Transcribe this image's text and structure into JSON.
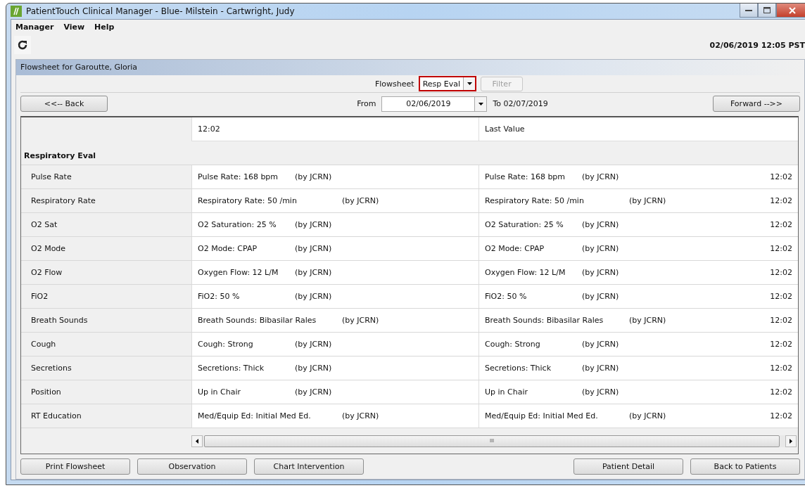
{
  "window": {
    "title": "PatientTouch Clinical Manager - Blue- Milstein - Cartwright, Judy"
  },
  "menu": [
    "Manager",
    "View",
    "Help"
  ],
  "toolbar": {
    "datetime": "02/06/2019 12:05 PST"
  },
  "panel": {
    "title": "Flowsheet for Garoutte, Gloria"
  },
  "flowsheet": {
    "label": "Flowsheet",
    "value": "Resp Eval",
    "highlighted": true,
    "filter": {
      "label": "Filter",
      "disabled": true
    }
  },
  "navigation": {
    "back": "<<-- Back",
    "from_label": "From",
    "from_value": "02/06/2019",
    "to_text": "To 02/07/2019",
    "forward": "Forward -->>"
  },
  "table": {
    "columns": [
      "12:02",
      "Last Value"
    ],
    "group": "Respiratory Eval",
    "rows": [
      {
        "label": "Pulse Rate",
        "value": "Pulse Rate: 168 bpm",
        "by": "(by JCRN)",
        "last_value": "Pulse Rate: 168 bpm",
        "last_by": "(by JCRN)",
        "time": "12:02"
      },
      {
        "label": "Respiratory Rate",
        "value": "Respiratory Rate: 50 /min",
        "by": "(by JCRN)",
        "last_value": "Respiratory Rate: 50 /min",
        "last_by": "(by JCRN)",
        "time": "12:02"
      },
      {
        "label": "O2 Sat",
        "value": "O2 Saturation: 25 %",
        "by": "(by JCRN)",
        "last_value": "O2 Saturation: 25 %",
        "last_by": "(by JCRN)",
        "time": "12:02"
      },
      {
        "label": "O2 Mode",
        "value": "O2 Mode: CPAP",
        "by": "(by JCRN)",
        "last_value": "O2 Mode: CPAP",
        "last_by": "(by JCRN)",
        "time": "12:02"
      },
      {
        "label": "O2 Flow",
        "value": "Oxygen Flow: 12 L/M",
        "by": "(by JCRN)",
        "last_value": "Oxygen Flow: 12 L/M",
        "last_by": "(by JCRN)",
        "time": "12:02"
      },
      {
        "label": "FiO2",
        "value": "FiO2: 50 %",
        "by": "(by JCRN)",
        "last_value": "FiO2: 50 %",
        "last_by": "(by JCRN)",
        "time": "12:02"
      },
      {
        "label": "Breath Sounds",
        "value": "Breath Sounds: Bibasilar Rales",
        "by": "(by JCRN)",
        "last_value": "Breath Sounds: Bibasilar Rales",
        "last_by": "(by JCRN)",
        "time": "12:02"
      },
      {
        "label": "Cough",
        "value": "Cough: Strong",
        "by": "(by JCRN)",
        "last_value": "Cough: Strong",
        "last_by": "(by JCRN)",
        "time": "12:02"
      },
      {
        "label": "Secretions",
        "value": "Secretions: Thick",
        "by": "(by JCRN)",
        "last_value": "Secretions: Thick",
        "last_by": "(by JCRN)",
        "time": "12:02"
      },
      {
        "label": "Position",
        "value": "Up in Chair",
        "by": "(by JCRN)",
        "last_value": "Up in Chair",
        "last_by": "(by JCRN)",
        "time": "12:02"
      },
      {
        "label": "RT Education",
        "value": "Med/Equip Ed: Initial Med Ed.",
        "by": "(by JCRN)",
        "last_value": "Med/Equip Ed: Initial Med Ed.",
        "last_by": "(by JCRN)",
        "time": "12:02"
      }
    ]
  },
  "scrollbar": {
    "grip": "III"
  },
  "buttons_left": [
    "Print Flowsheet",
    "Observation",
    "Chart Intervention"
  ],
  "buttons_right": [
    "Patient Detail",
    "Back to Patients"
  ]
}
